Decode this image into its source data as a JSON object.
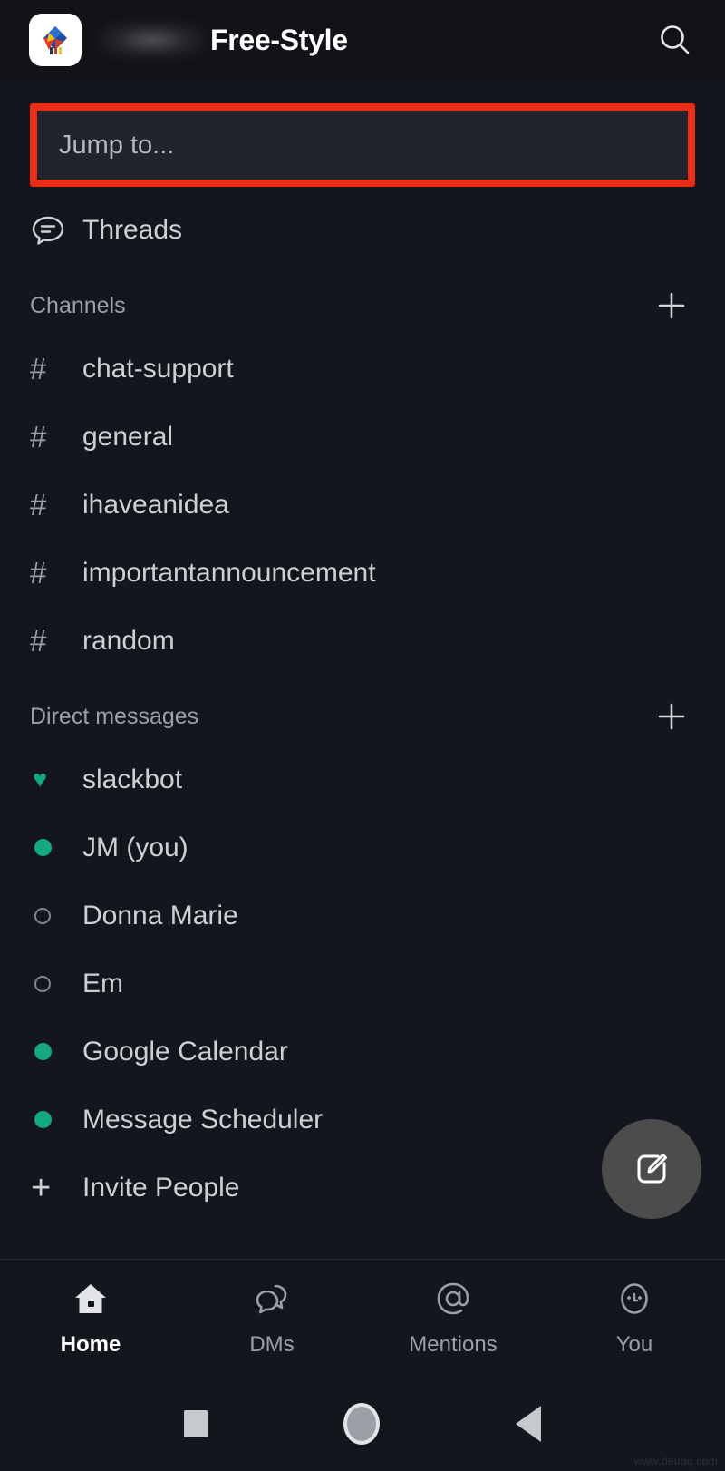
{
  "header": {
    "workspace_logo_icon": "workspace-diamond-logo",
    "workspace_name_redacted": "",
    "title": "Free-Style",
    "search_icon": "search-icon"
  },
  "search": {
    "placeholder": "Jump to...",
    "value": "",
    "highlight_color": "#ee2b14"
  },
  "threads": {
    "label": "Threads",
    "icon": "threads-bubble-icon"
  },
  "channels_section": {
    "title": "Channels",
    "add_icon": "plus-icon",
    "items": [
      {
        "prefix": "#",
        "label": "chat-support"
      },
      {
        "prefix": "#",
        "label": "general"
      },
      {
        "prefix": "#",
        "label": "ihaveanidea"
      },
      {
        "prefix": "#",
        "label": "importantannouncement"
      },
      {
        "prefix": "#",
        "label": "random"
      }
    ]
  },
  "dms_section": {
    "title": "Direct messages",
    "add_icon": "plus-icon",
    "items": [
      {
        "label": "slackbot",
        "presence": "heart",
        "presence_color": "#14a97f"
      },
      {
        "label": "JM (you)",
        "presence": "online",
        "presence_color": "#14a97f"
      },
      {
        "label": "Donna Marie",
        "presence": "offline",
        "presence_color": "#7e858e"
      },
      {
        "label": "Em",
        "presence": "offline",
        "presence_color": "#7e858e"
      },
      {
        "label": "Google Calendar",
        "presence": "online",
        "presence_color": "#14a97f"
      },
      {
        "label": "Message Scheduler",
        "presence": "online",
        "presence_color": "#14a97f"
      }
    ],
    "invite": {
      "label": "Invite People",
      "icon": "plus-icon"
    }
  },
  "compose_fab": {
    "icon": "compose-pencil-icon",
    "background": "#4c4c4c"
  },
  "tabbar": {
    "tabs": [
      {
        "label": "Home",
        "icon": "home-icon",
        "active": true
      },
      {
        "label": "DMs",
        "icon": "dms-bubbles-icon",
        "active": false
      },
      {
        "label": "Mentions",
        "icon": "at-mention-icon",
        "active": false
      },
      {
        "label": "You",
        "icon": "you-face-icon",
        "active": false
      }
    ]
  },
  "system_nav": {
    "recents_icon": "square-recents-icon",
    "home_icon": "circle-home-icon",
    "back_icon": "triangle-back-icon"
  },
  "watermark": "www.deuaq.com"
}
